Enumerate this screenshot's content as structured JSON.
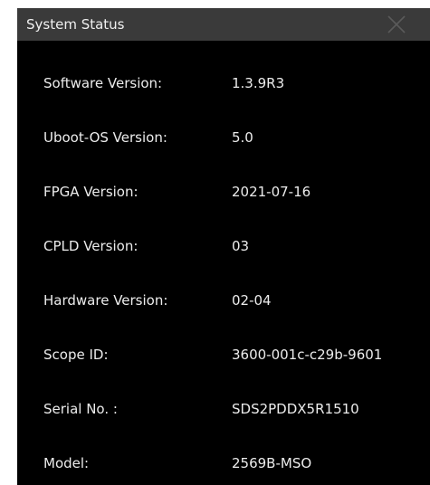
{
  "dialog": {
    "title": "System Status",
    "close_icon": "close-icon"
  },
  "rows": [
    {
      "label": "Software Version:",
      "value": "1.3.9R3"
    },
    {
      "label": "Uboot-OS Version:",
      "value": "5.0"
    },
    {
      "label": "FPGA Version:",
      "value": "2021-07-16"
    },
    {
      "label": "CPLD Version:",
      "value": "03"
    },
    {
      "label": "Hardware Version:",
      "value": "02-04"
    },
    {
      "label": "Scope ID:",
      "value": "3600-001c-c29b-9601"
    },
    {
      "label": "Serial No. :",
      "value": "SDS2PDDX5R1510"
    },
    {
      "label": "Model:",
      "value": "2569B-MSO"
    }
  ],
  "colors": {
    "background": "#000000",
    "titlebar": "#3a3a3a",
    "text": "#ececec"
  }
}
